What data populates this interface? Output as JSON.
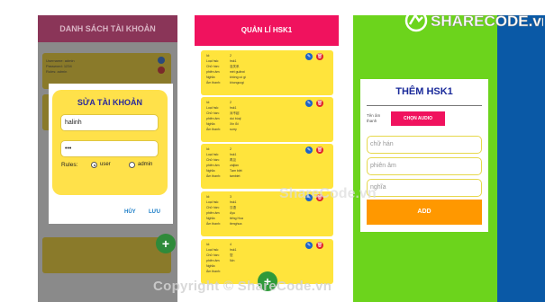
{
  "panel1": {
    "header": "DANH SÁCH TÀI KHOẢN",
    "card1_rows": [
      {
        "label": "Username:",
        "value": "admin"
      },
      {
        "label": "Password:",
        "value": "1234"
      },
      {
        "label": "Rules:",
        "value": "admin"
      }
    ],
    "dialog": {
      "title": "SỬA TÀI KHOẢN",
      "username_value": "halinh",
      "password_value": "•••",
      "rules_label": "Rules:",
      "rule_user": "user",
      "rule_admin": "admin",
      "cancel": "HỦY",
      "save": "LƯU"
    },
    "fab": "+"
  },
  "panel2": {
    "header": "QUẢN LÍ HSK1",
    "cards": [
      {
        "id": "2",
        "type": "hsk1",
        "chinese": "没关系",
        "pinyin": "méi guānxi",
        "meaning": "không có gì",
        "audio": "khongcogi"
      },
      {
        "id": "2",
        "type": "hsk1",
        "chinese": "对不起",
        "pinyin": "duì bùqǐ",
        "meaning": "Xin lỗi",
        "audio": "sorry"
      },
      {
        "id": "2",
        "type": "hsk1",
        "chinese": "再见",
        "pinyin": "zàijiàn",
        "meaning": "Tạm biệt",
        "audio": "tambiet"
      },
      {
        "id": "3",
        "type": "hsk1",
        "chinese": "汉语",
        "pinyin": "Ạyu",
        "meaning": "tiếng Hoa",
        "audio": "tienghoa"
      },
      {
        "id": "4",
        "type": "hsk1",
        "chinese": "您",
        "pinyin": "Nín",
        "meaning": "",
        "audio": ""
      }
    ],
    "labels": {
      "id": "Id:",
      "type": "Loại hsk:",
      "chinese": "Chữ hán:",
      "pinyin": "phiên âm:",
      "meaning": "Nghĩa:",
      "audio": "Âm thanh:"
    },
    "fab": "+"
  },
  "panel3": {
    "title": "THÊM HSK1",
    "audio_label": "Tên âm thanh",
    "audio_button": "CHỌN AUDIO",
    "input_chinese_placeholder": "chữ hán",
    "input_pinyin_placeholder": "phiên âm",
    "input_meaning_placeholder": "nghĩa",
    "add_button": "ADD"
  },
  "watermark": {
    "logo_text": "SHARECODE.vn",
    "center_text": "ShareCode.vn",
    "bottom_text": "Copyright © ShareCode.vn"
  },
  "colors": {
    "pink_header": "#f0125e",
    "card_yellow": "#ffe43c",
    "green_bg": "#6cd41c",
    "blue_bg": "#0a59a6",
    "orange": "#ff9800"
  }
}
